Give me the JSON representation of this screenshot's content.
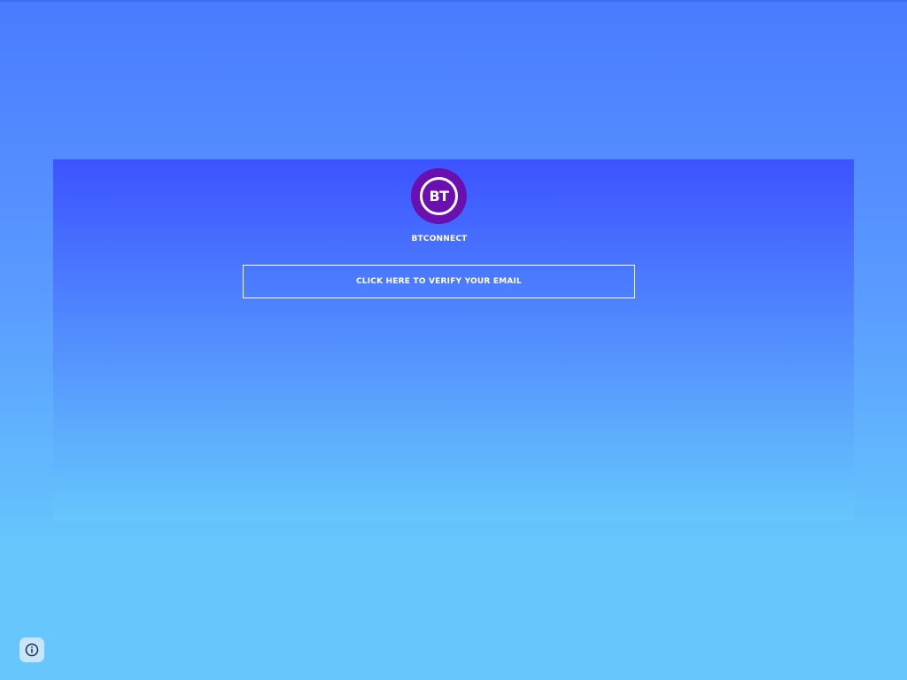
{
  "logo": {
    "text": "BT",
    "background_color": "#6a0fb0",
    "icon": "bt-logo-icon"
  },
  "brand": {
    "name": "BTCONNECT"
  },
  "verify": {
    "label": "CLICK HERE TO VERIFY YOUR EMAIL"
  },
  "info": {
    "icon": "info-icon"
  },
  "colors": {
    "panel_top": "#3c53ff",
    "panel_bottom": "#66c7fc",
    "page_top": "#4a7bff",
    "page_bottom": "#67c7fc"
  }
}
